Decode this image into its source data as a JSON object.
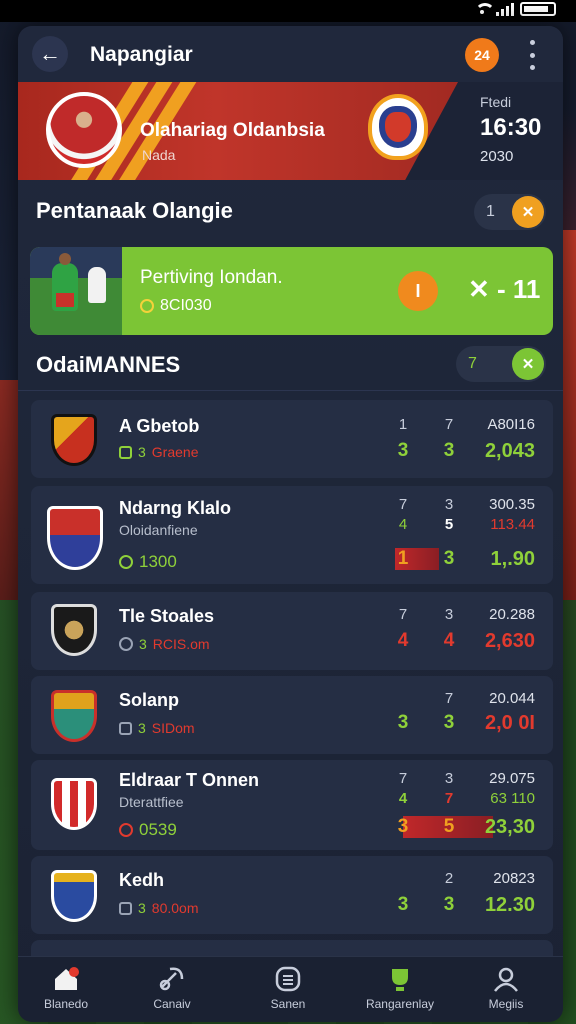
{
  "status": {
    "icons": [
      "wifi-icon",
      "signal-icon",
      "battery-icon"
    ]
  },
  "header": {
    "title": "Napangiar",
    "badge": "24"
  },
  "banner": {
    "title": "Olahariag Oldanbsia",
    "subtitle": "Nada",
    "label": "Ftedi",
    "time": "16:30",
    "small": "2030"
  },
  "featured_section": {
    "title": "Pentanaak Olangie",
    "pill": "1"
  },
  "featured": {
    "title": "Pertiving Iondan.",
    "sub": "8CI030",
    "button": "I",
    "score": "✕ - 11"
  },
  "matches_section": {
    "title": "OdaiMANNES",
    "pill": "7"
  },
  "matches": [
    {
      "name": "A Gbetob",
      "meta_a": "3",
      "meta_b": "Graene",
      "h1": "1",
      "h2": "7",
      "v1": "3",
      "v2": "3",
      "odd_top": "A80I16",
      "odd_big": "2,043"
    },
    {
      "name": "Ndarng Klalo",
      "sub": "Oloidanfiene",
      "meta": "1300",
      "h1": "7",
      "h2": "3",
      "m1": "4",
      "m2": "5",
      "v1": "1",
      "v2": "3",
      "odd_top": "300.35",
      "odd_mid": "113.44",
      "odd_big": "1,.90"
    },
    {
      "name": "Tle Stoales",
      "meta_a": "3",
      "meta_b": "RCIS.om",
      "h1": "7",
      "h2": "3",
      "v1": "4",
      "v2": "4",
      "odd_top": "20.288",
      "odd_big": "2,630"
    },
    {
      "name": "Solanp",
      "meta_a": "3",
      "meta_b": "SIDom",
      "h2": "7",
      "v1": "3",
      "v2": "3",
      "odd_top": "20.044",
      "odd_big": "2,0 0I"
    },
    {
      "name": "Eldraar T Onnen",
      "sub": "Dterattfiee",
      "meta": "0539",
      "h1": "7",
      "h2": "3",
      "m1": "4",
      "m2": "7",
      "v1": "3",
      "v2": "5",
      "odd_top": "29.075",
      "odd_mid": "63 110",
      "odd_big": "23,30"
    },
    {
      "name": "Kedh",
      "meta_a": "3",
      "meta_b": "80.0om",
      "h2": "2",
      "v1": "3",
      "v2": "3",
      "odd_top": "20823",
      "odd_big": "12.30"
    }
  ],
  "nav": [
    {
      "label": "Blanedo",
      "icon": "home-icon"
    },
    {
      "label": "Canaiv",
      "icon": "whistle-icon"
    },
    {
      "label": "Sanen",
      "icon": "list-icon"
    },
    {
      "label": "Rangarenlay",
      "icon": "trophy-icon"
    },
    {
      "label": "Megiis",
      "icon": "profile-icon"
    }
  ],
  "colors": {
    "accent": "#f07a1a",
    "green": "#7cc535",
    "red": "#c0352a",
    "panel": "#20283c"
  }
}
